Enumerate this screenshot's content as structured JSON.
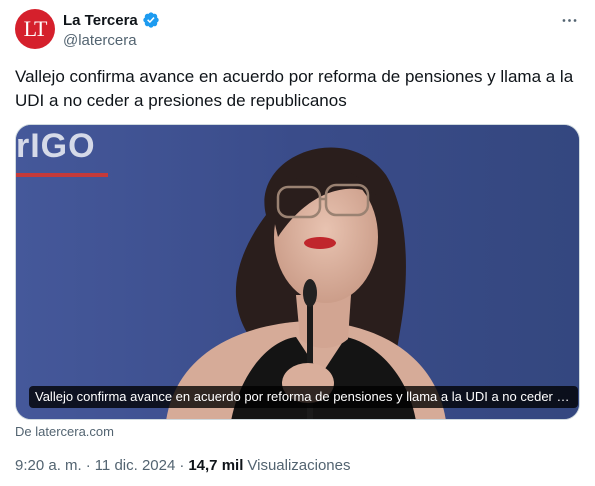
{
  "author": {
    "avatar_text": "LT",
    "avatar_color": "#d5202c",
    "name": "La Tercera",
    "handle": "@latercera",
    "verified_icon": "verified-badge-icon",
    "verified_color": "#1d9bf0"
  },
  "more_icon": "more-horizontal-icon",
  "tweet": {
    "text": "Vallejo confirma avance en acuerdo por reforma de pensiones y llama a la UDI a no ceder a presiones de republicanos"
  },
  "card": {
    "brand_fragment": "rIGO",
    "caption": "Vallejo confirma avance en acuerdo por reforma de pensiones y llama a la UDI a no ceder a presiones de republicanos",
    "source": "De latercera.com"
  },
  "meta": {
    "time": "9:20 a. m.",
    "separator": "·",
    "date": "11 dic. 2024",
    "separator2": "·",
    "views_count": "14,7 mil",
    "views_label": "Visualizaciones"
  }
}
